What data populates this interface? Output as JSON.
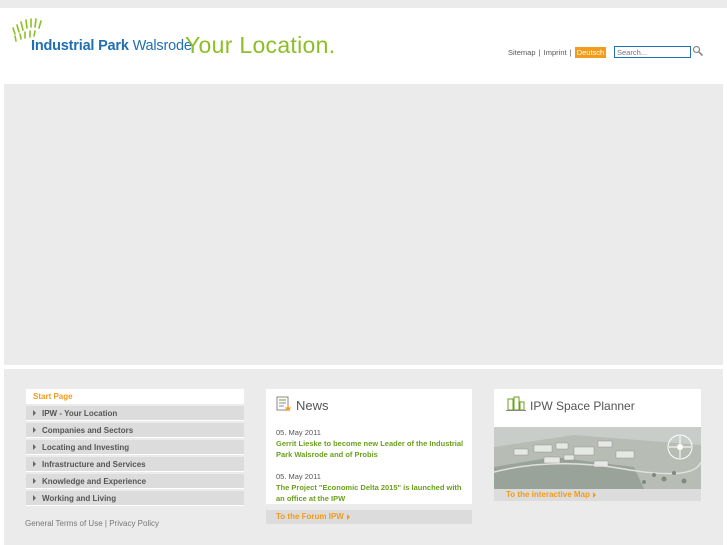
{
  "header": {
    "logo_bold": "Industrial Park",
    "logo_light": "Walsrode",
    "slogan": "Your Location.",
    "sitemap": "Sitemap",
    "imprint": "Imprint",
    "language": "Deutsch",
    "search_placeholder": "Search..."
  },
  "nav": {
    "start": "Start Page",
    "items": [
      "IPW - Your Location",
      "Companies and Sectors",
      "Locating and Investing",
      "Infrastructure and Services",
      "Knowledge and Experience",
      "Working and Living"
    ]
  },
  "footer": {
    "terms": "General Terms of Use",
    "privacy": "Privacy Policy"
  },
  "news": {
    "title": "News",
    "items": [
      {
        "date": "05. May 2011",
        "headline": "Gerrit Lieske to become new Leader of the Industrial Park Walsrode and of Probis"
      },
      {
        "date": "05. May 2011",
        "headline": "The Project \"Economic Delta 2015\" is launched with an office at the IPW"
      }
    ],
    "forum_link": "To the Forum IPW"
  },
  "planner": {
    "title": "IPW Space Planner",
    "map_link": "To the interactive Map"
  },
  "colors": {
    "brand_blue": "#1f6fb3",
    "brand_green": "#8cbf26",
    "accent_orange": "#f29b1d"
  }
}
